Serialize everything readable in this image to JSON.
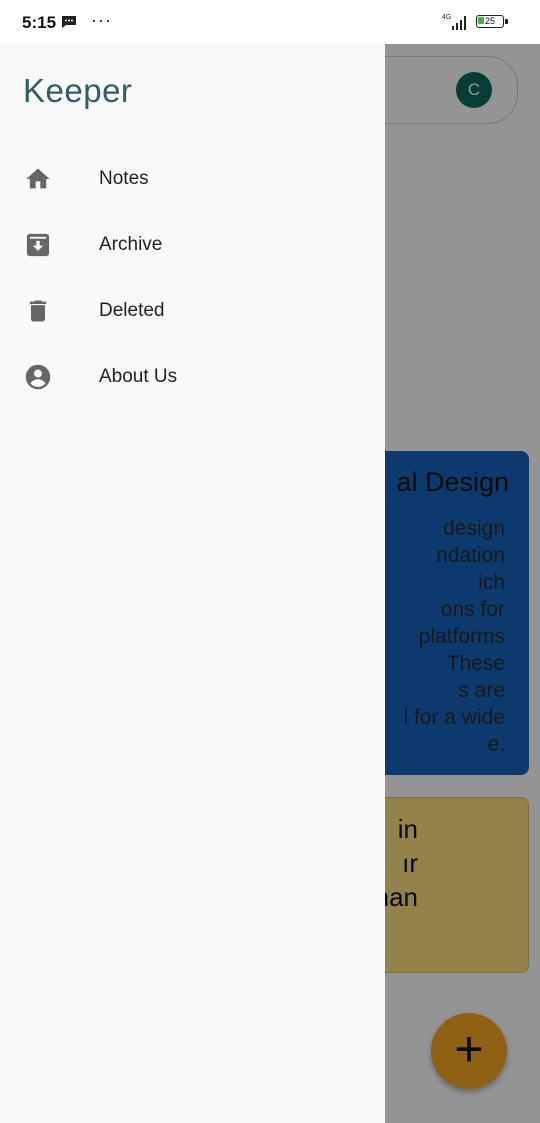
{
  "status_bar": {
    "time": "5:15",
    "message_icon": "message-icon",
    "more_dots": "···",
    "network_label": "4G",
    "battery_level": "25",
    "battery_percent": 25
  },
  "drawer": {
    "brand": "Keeper",
    "items": [
      {
        "label": "Notes",
        "icon": "home-icon"
      },
      {
        "label": "Archive",
        "icon": "archive-icon"
      },
      {
        "label": "Deleted",
        "icon": "trash-icon"
      },
      {
        "label": "About Us",
        "icon": "account-circle-icon"
      }
    ]
  },
  "background": {
    "avatar_letter": "C",
    "note1": {
      "title_visible": "al Design",
      "body_lines": [
        "design",
        "ndation",
        "ich",
        "ons for",
        "platforms",
        "These",
        "s are",
        "l for a wide",
        "e."
      ],
      "color": "#1565c0"
    },
    "note2": {
      "lines": [
        "in",
        "ır",
        "han"
      ],
      "color": "#ffe082"
    },
    "fab_label": "+"
  },
  "colors": {
    "brand": "#2f5f62",
    "avatar": "#0b6b5c",
    "fab": "#f9a825",
    "drawer_bg": "#f9f9f9"
  }
}
